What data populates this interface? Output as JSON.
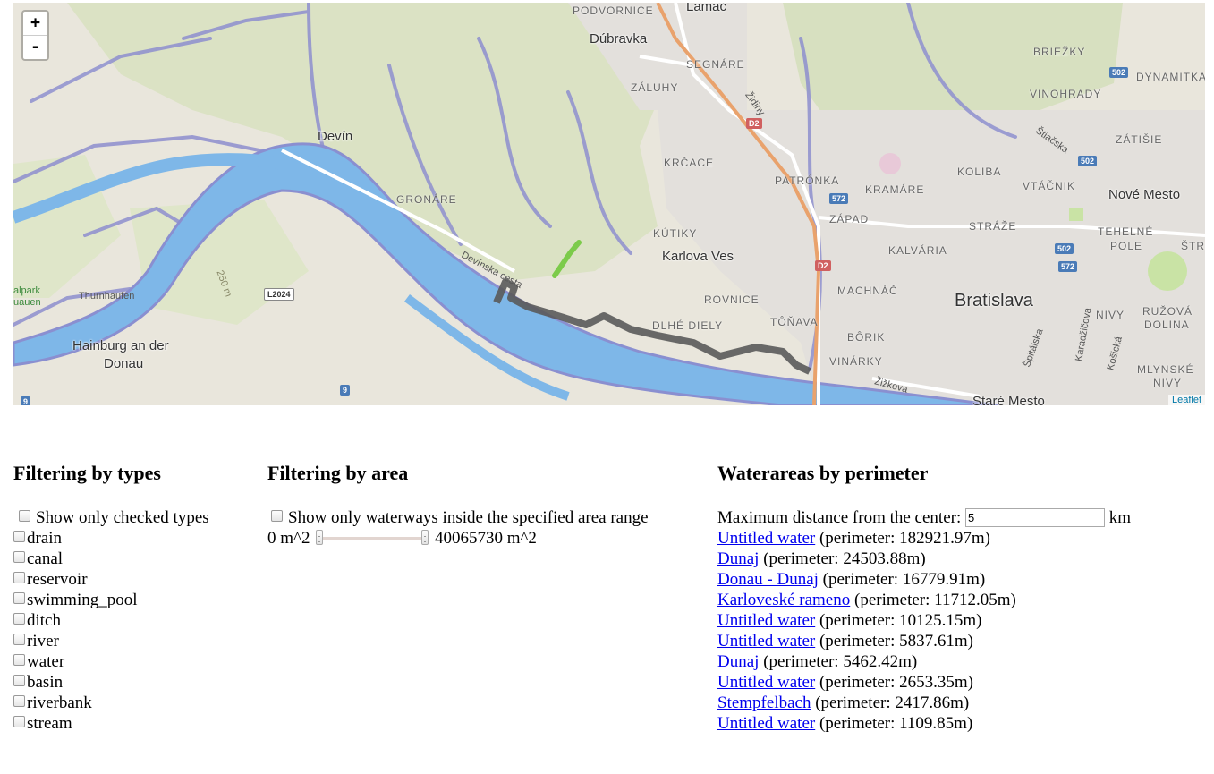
{
  "map": {
    "zoom_in": "+",
    "zoom_out": "-",
    "attribution": "Leaflet",
    "places": {
      "lamac": "Lamač",
      "dubravka": "Dúbravka",
      "podvornice": "PODVORNICE",
      "segnare": "SEGNÁRE",
      "zaluhy": "ZÁLUHY",
      "devin": "Devín",
      "krcace": "KRČACE",
      "gronare": "GRONÁRE",
      "kutiky": "KÚTIKY",
      "karlova_ves": "Karlova Ves",
      "rovnice": "ROVNICE",
      "dlhe_diely": "DLHÉ DIELY",
      "tonava": "TÔŇAVA",
      "patronka": "PATRÓNKA",
      "kramare": "KRAMÁRE",
      "zapad": "ZÁPAD",
      "machnac": "MACHNÁČ",
      "borik": "BÔRIK",
      "vinarky": "VINÁRKY",
      "kalvaria": "KALVÁRIA",
      "straze": "STRÁŽE",
      "koliba": "KOLIBA",
      "vtacnik": "VTÁČNIK",
      "bratislava": "Bratislava",
      "nove_mesto": "Nové Mesto",
      "stare_mesto": "Staré Mesto",
      "briezky": "BRIEŽKY",
      "dynamitka": "DYNAMITKA",
      "vinohrady": "VINOHRADY",
      "zatisie": "ZÁTIŠIE",
      "tehelne_pole_1": "TEHELNÉ",
      "tehelne_pole_2": "POLE",
      "strk": "ŠTRK",
      "nivy": "NIVY",
      "ruzova_1": "RUŽOVÁ",
      "ruzova_2": "DOLINA",
      "mlynske_1": "MLYNSKÉ",
      "mlynske_2": "NIVY",
      "hainburg_1": "Hainburg an der",
      "hainburg_2": "Donau",
      "thurnhaufen": "Thurnhaufen",
      "alpark_1": "alpark",
      "alpark_2": "uauen",
      "devinska_cesta": "Devínska cesta",
      "zidiny": "Židiny",
      "stiacska": "Štiačska",
      "spitalska": "Špitálska",
      "karadzicova": "Karadžičova",
      "kosicka": "Košická",
      "zizkova": "Žižkova",
      "contour": "250 m"
    },
    "shields": {
      "d2a": "D2",
      "d2b": "D2",
      "l2024": "L2024",
      "r9a": "9",
      "r9b": "9",
      "r502a": "502",
      "r502b": "502",
      "r502c": "502",
      "r572a": "572",
      "r572b": "572"
    }
  },
  "types_filter": {
    "heading": "Filtering by types",
    "show_only_label": "Show only checked types",
    "types": [
      "drain",
      "canal",
      "reservoir",
      "swimming_pool",
      "ditch",
      "river",
      "water",
      "basin",
      "riverbank",
      "stream"
    ]
  },
  "area_filter": {
    "heading": "Filtering by area",
    "show_only_label": "Show only waterways inside the specified area range",
    "min_label": "0 m^2",
    "max_label": "40065730 m^2"
  },
  "perimeter": {
    "heading": "Waterareas by perimeter",
    "distance_label": "Maximum distance from the center:",
    "distance_value": "5",
    "distance_unit": "km",
    "items": [
      {
        "name": "Untitled water",
        "detail": " (perimeter: 182921.97m)"
      },
      {
        "name": "Dunaj",
        "detail": " (perimeter: 24503.88m)"
      },
      {
        "name": "Donau - Dunaj",
        "detail": " (perimeter: 16779.91m)"
      },
      {
        "name": "Karloveské rameno",
        "detail": " (perimeter: 11712.05m)"
      },
      {
        "name": "Untitled water",
        "detail": " (perimeter: 10125.15m)"
      },
      {
        "name": "Untitled water",
        "detail": " (perimeter: 5837.61m)"
      },
      {
        "name": "Dunaj",
        "detail": " (perimeter: 5462.42m)"
      },
      {
        "name": "Untitled water",
        "detail": " (perimeter: 2653.35m)"
      },
      {
        "name": "Stempfelbach",
        "detail": " (perimeter: 2417.86m)"
      },
      {
        "name": "Untitled water",
        "detail": " (perimeter: 1109.85m)"
      }
    ]
  }
}
